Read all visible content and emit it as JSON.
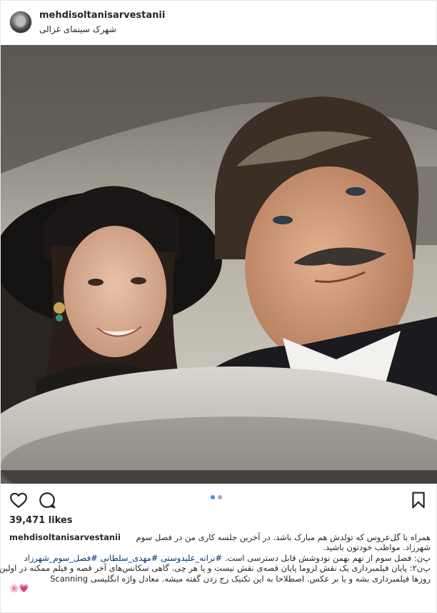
{
  "header": {
    "username": "mehdisoltanisarvestanii",
    "location": "شهرک سینمای غزالی"
  },
  "actions": {
    "like_icon": "heart-outline-icon",
    "comment_icon": "speech-bubble-icon",
    "save_icon": "bookmark-icon",
    "carousel_pages": 2,
    "carousel_active": 1
  },
  "likes": "39,471 likes",
  "caption": {
    "username": "mehdisoltanisarvestanii",
    "line1": "همراه با گل‌عروس که تولدش هم مبارک باشد. در آخرین جلسه کاری من در فصل سوم",
    "line2": "شهرزاد. مواظب خودتون باشید.",
    "line3_text": "پ‌ن: فصل سوم از نهم بهمن نودوشش قابل دسترسی است.",
    "tags": [
      "#ترانه_علیدوستی",
      "#مهدی_سلطانی",
      "#فصل_سوم_شهرزاد"
    ],
    "line4": "پ‌ن۲: پایان فیلمبرداری یک نقش لزوما پایان قصه‌ی نقش نیست و یا هر چی. گاهی سکانس‌های آخر قصه و فیلم ممکنه در اولین",
    "line5": "روزها فیلمبرداری بشه و یا بر عکس. اصطلاحا به این تکنیک رج زدن گفته میشه. معادل واژه انگلیسی Scanning",
    "line6_emoji": [
      "🌸",
      "💗"
    ]
  }
}
